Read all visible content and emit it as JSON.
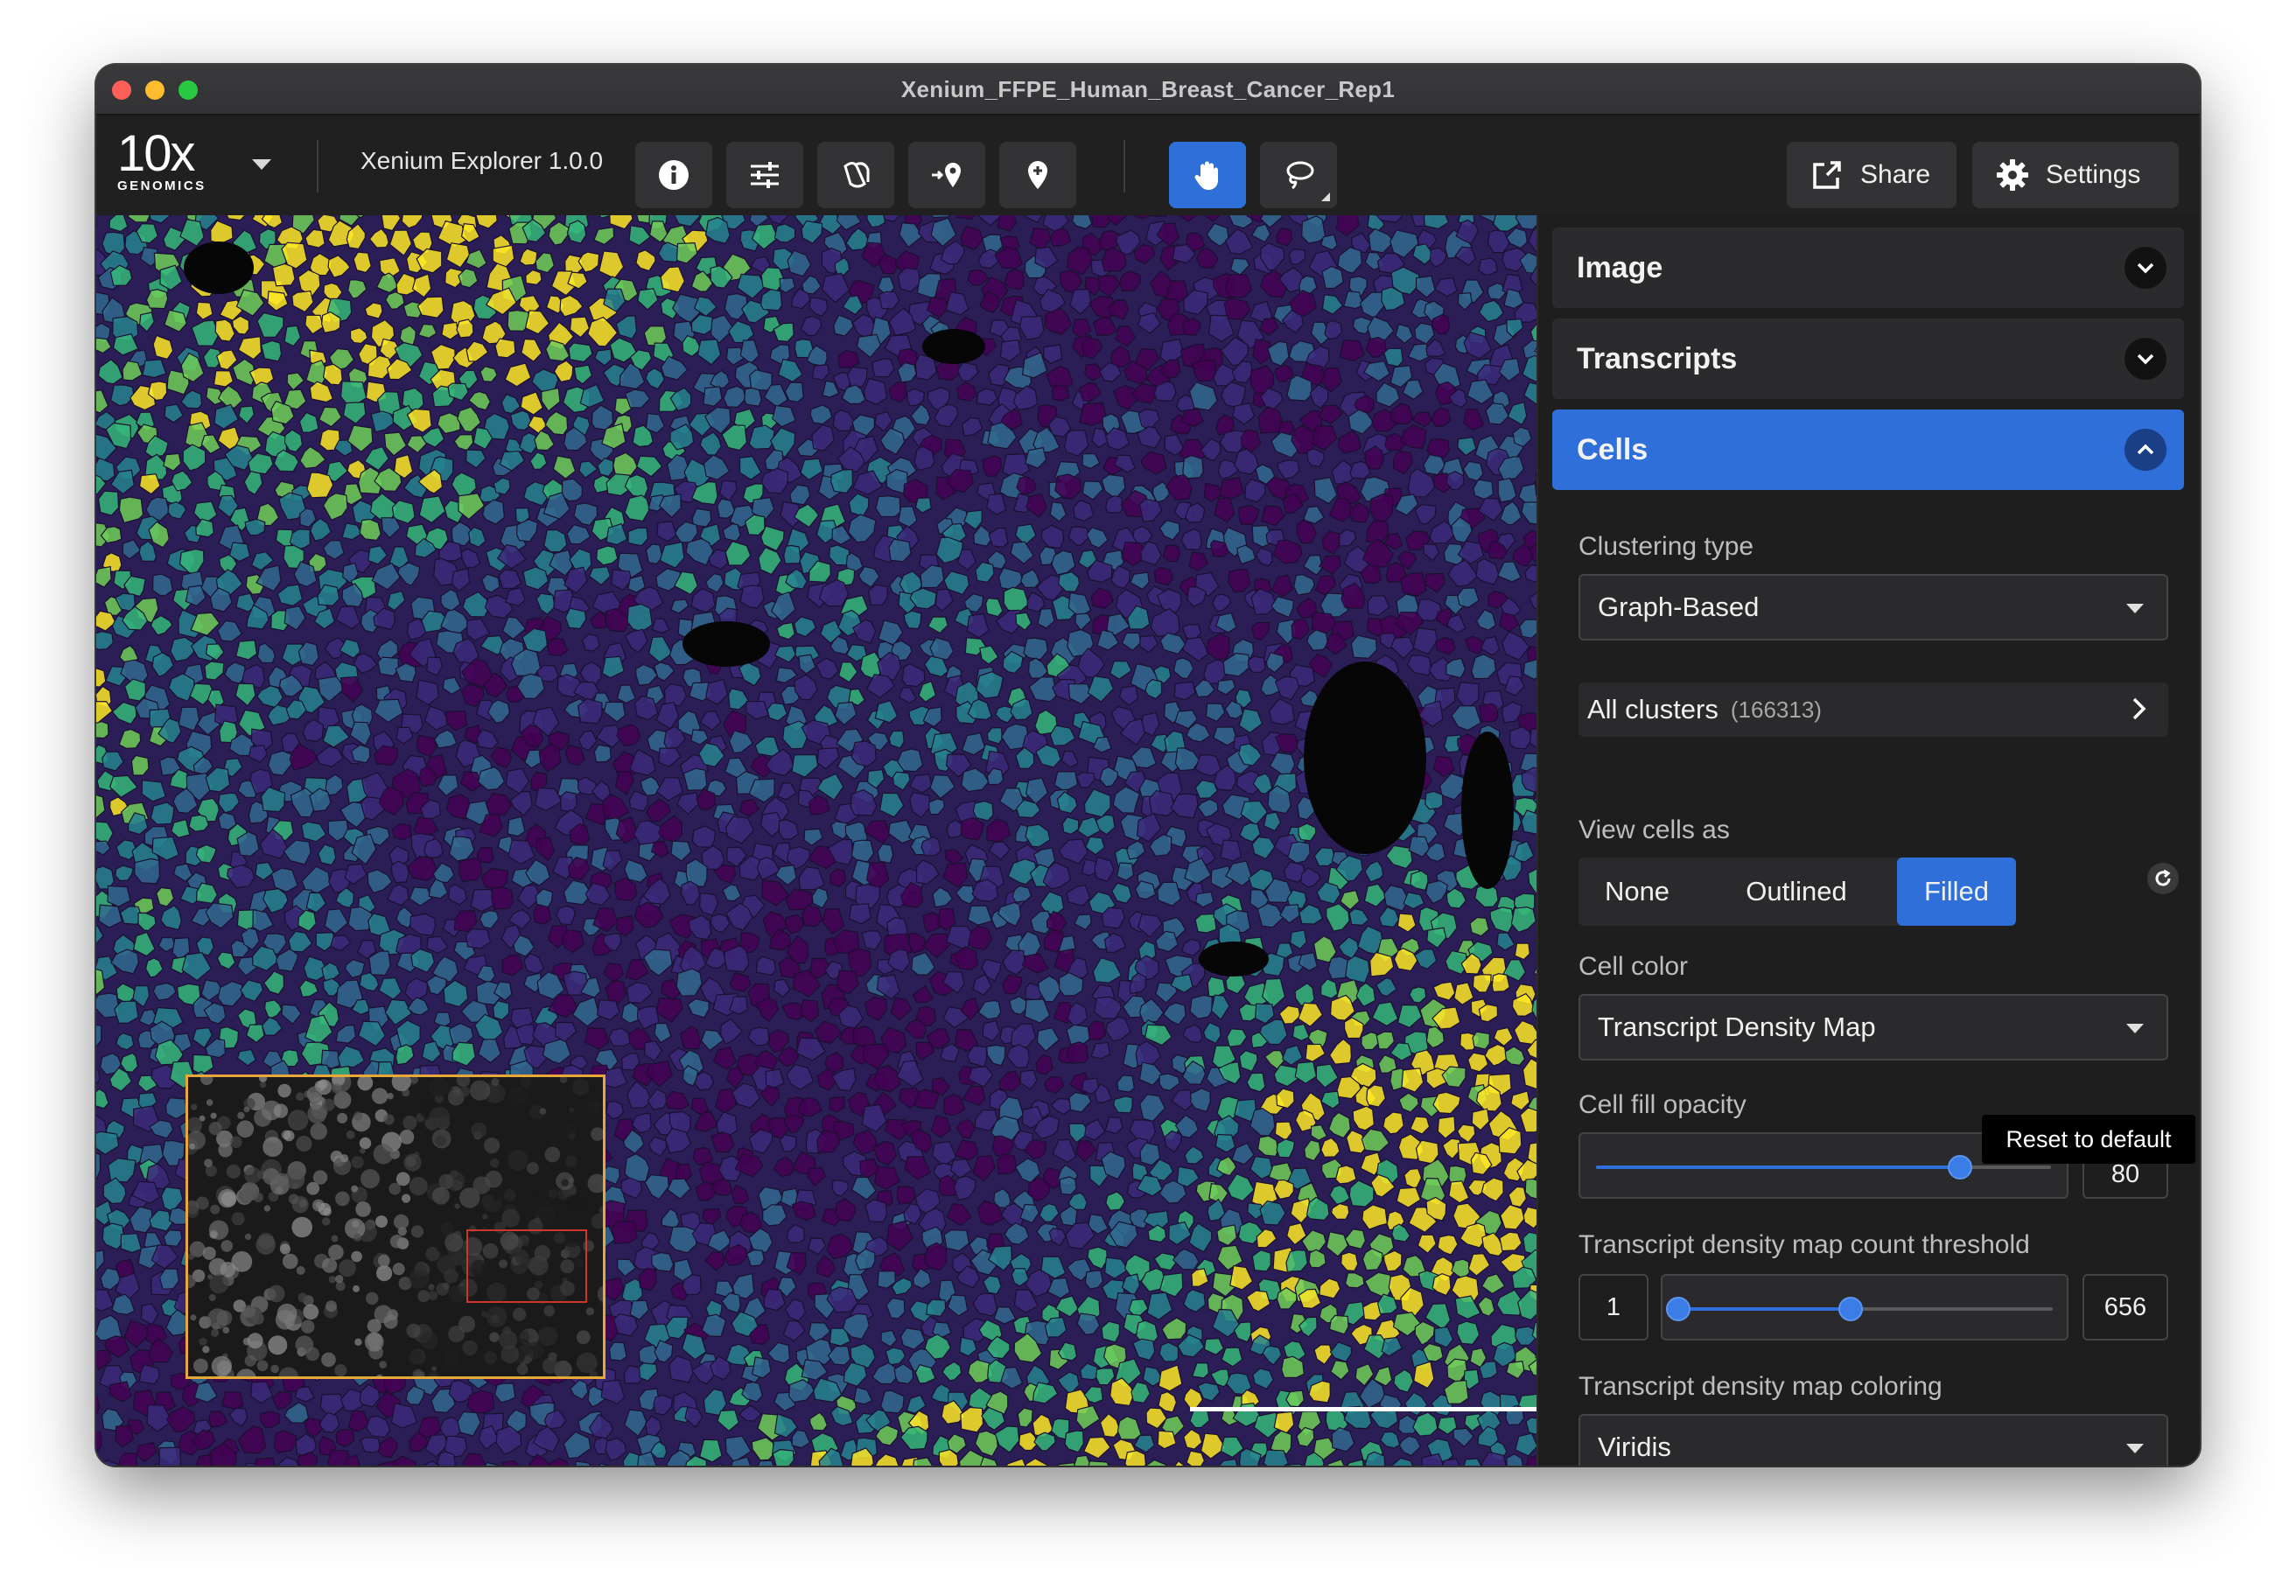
{
  "window": {
    "title": "Xenium_FFPE_Human_Breast_Cancer_Rep1"
  },
  "toolbar": {
    "logo_big": "10x",
    "logo_small": "GENOMICS",
    "app_name": "Xenium Explorer 1.0.0",
    "tools": [
      "info-icon",
      "sliders-icon",
      "flip-icon",
      "add-location-icon",
      "pin-icon",
      "hand-icon",
      "lasso-icon"
    ],
    "share_label": "Share",
    "settings_label": "Settings"
  },
  "panel": {
    "image_label": "Image",
    "transcripts_label": "Transcripts",
    "cells_label": "Cells",
    "clustering_type_label": "Clustering type",
    "clustering_type_value": "Graph-Based",
    "all_clusters_label": "All clusters",
    "all_clusters_count": "(166313)",
    "view_cells_label": "View cells as",
    "view_options": [
      "None",
      "Outlined",
      "Filled"
    ],
    "view_selected": "Filled",
    "cell_color_label": "Cell color",
    "cell_color_value": "Transcript Density Map",
    "opacity_label": "Cell fill opacity",
    "opacity_value": "80",
    "opacity_fraction": 0.8,
    "tooltip": "Reset to default",
    "threshold_label": "Transcript density map count threshold",
    "threshold_min": "1",
    "threshold_max": "656",
    "threshold_low_fraction": 0.0,
    "threshold_high_fraction": 0.46,
    "coloring_label": "Transcript density map coloring",
    "coloring_value": "Viridis"
  },
  "colors": {
    "accent": "#2e6fd9",
    "viridis": [
      "#440154",
      "#3b2a7a",
      "#31688e",
      "#26828e",
      "#35b779",
      "#6ece58",
      "#fde725"
    ]
  }
}
